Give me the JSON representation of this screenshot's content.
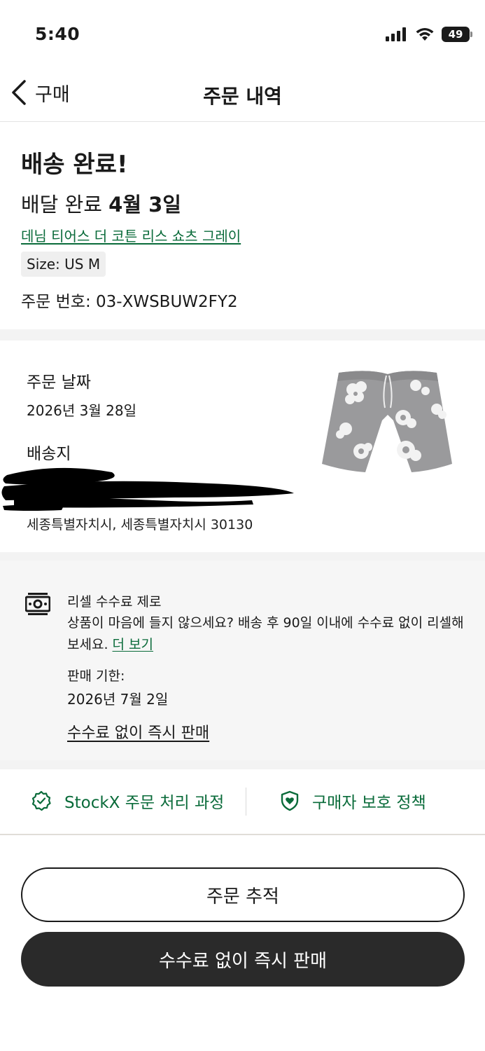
{
  "status_bar": {
    "time": "5:40",
    "battery": "49"
  },
  "nav": {
    "back_label": "구매",
    "title": "주문 내역"
  },
  "delivery": {
    "heading": "배송 완료!",
    "date_prefix": "배달 완료 ",
    "date_value": "4월 3일",
    "product_name": "데님 티어스 더 코튼 리스 쇼츠 그레이",
    "size": "Size: US M",
    "order_number": "주문 번호: 03-XWSBUW2FY2"
  },
  "order_info": {
    "date_label": "주문 날짜",
    "date_value": "2026년 3월 28일",
    "shipping_label": "배송지",
    "address": "세종특별자치시, 세종특별자치시 30130"
  },
  "resell": {
    "title": "리셀 수수료 제로",
    "description": "상품이 마음에 들지 않으세요? 배송 후 90일 이내에 수수료 없이 리셀해 보세요.",
    "more_link": "더 보기",
    "deadline_label": "판매 기한:",
    "deadline_value": "2026년 7월 2일",
    "sell_link": "수수료 없이 즉시 판매"
  },
  "policies": {
    "process_label": "StockX 주문 처리 과정",
    "protection_label": "구매자 보호 정책"
  },
  "buttons": {
    "track": "주문 추적",
    "sell": "수수료 없이 즉시 판매"
  },
  "colors": {
    "accent_green": "#0a6b3a",
    "dark_button": "#2a2a2a",
    "section_gray": "#f6f6f6"
  },
  "icons": [
    "back-chevron-icon",
    "signal-icon",
    "wifi-icon",
    "battery-icon",
    "money-icon",
    "verified-badge-icon",
    "shield-heart-icon"
  ]
}
